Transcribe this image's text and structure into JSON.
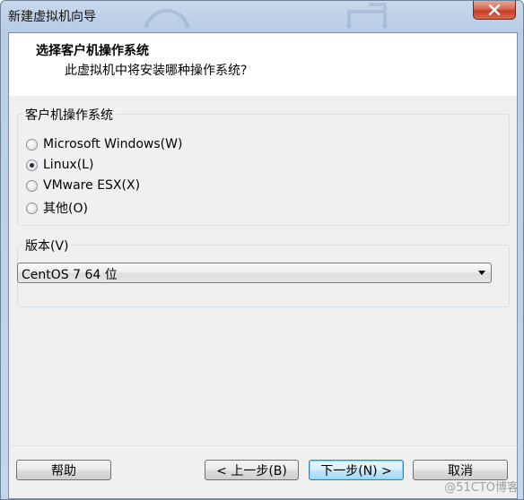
{
  "window": {
    "title": "新建虚拟机向导"
  },
  "header": {
    "title": "选择客户机操作系统",
    "subtitle": "此虚拟机中将安装哪种操作系统?"
  },
  "guest_os_group": {
    "label": "客户机操作系统",
    "options": [
      {
        "label": "Microsoft Windows(W)",
        "checked": false
      },
      {
        "label": "Linux(L)",
        "checked": true
      },
      {
        "label": "VMware ESX(X)",
        "checked": false
      },
      {
        "label": "其他(O)",
        "checked": false
      }
    ]
  },
  "version_group": {
    "label": "版本(V)",
    "selected": "CentOS 7 64 位"
  },
  "buttons": {
    "help": "帮助",
    "back": "< 上一步(B)",
    "next": "下一步(N) >",
    "cancel": "取消"
  },
  "watermark": "@51CTO博客",
  "colors": {
    "accent_default_button": "#3c7fb1",
    "close_button": "#c53e24"
  }
}
